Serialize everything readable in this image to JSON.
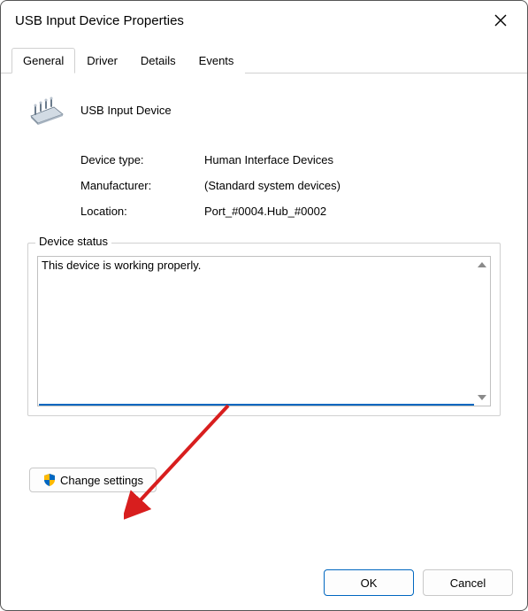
{
  "window": {
    "title": "USB Input Device Properties"
  },
  "tabs": [
    {
      "label": "General",
      "active": true
    },
    {
      "label": "Driver",
      "active": false
    },
    {
      "label": "Details",
      "active": false
    },
    {
      "label": "Events",
      "active": false
    }
  ],
  "device": {
    "name": "USB Input Device",
    "type_label": "Device type:",
    "type_value": "Human Interface Devices",
    "manufacturer_label": "Manufacturer:",
    "manufacturer_value": "(Standard system devices)",
    "location_label": "Location:",
    "location_value": "Port_#0004.Hub_#0002"
  },
  "status": {
    "legend": "Device status",
    "text": "This device is working properly."
  },
  "buttons": {
    "change_settings": "Change settings",
    "ok": "OK",
    "cancel": "Cancel"
  }
}
